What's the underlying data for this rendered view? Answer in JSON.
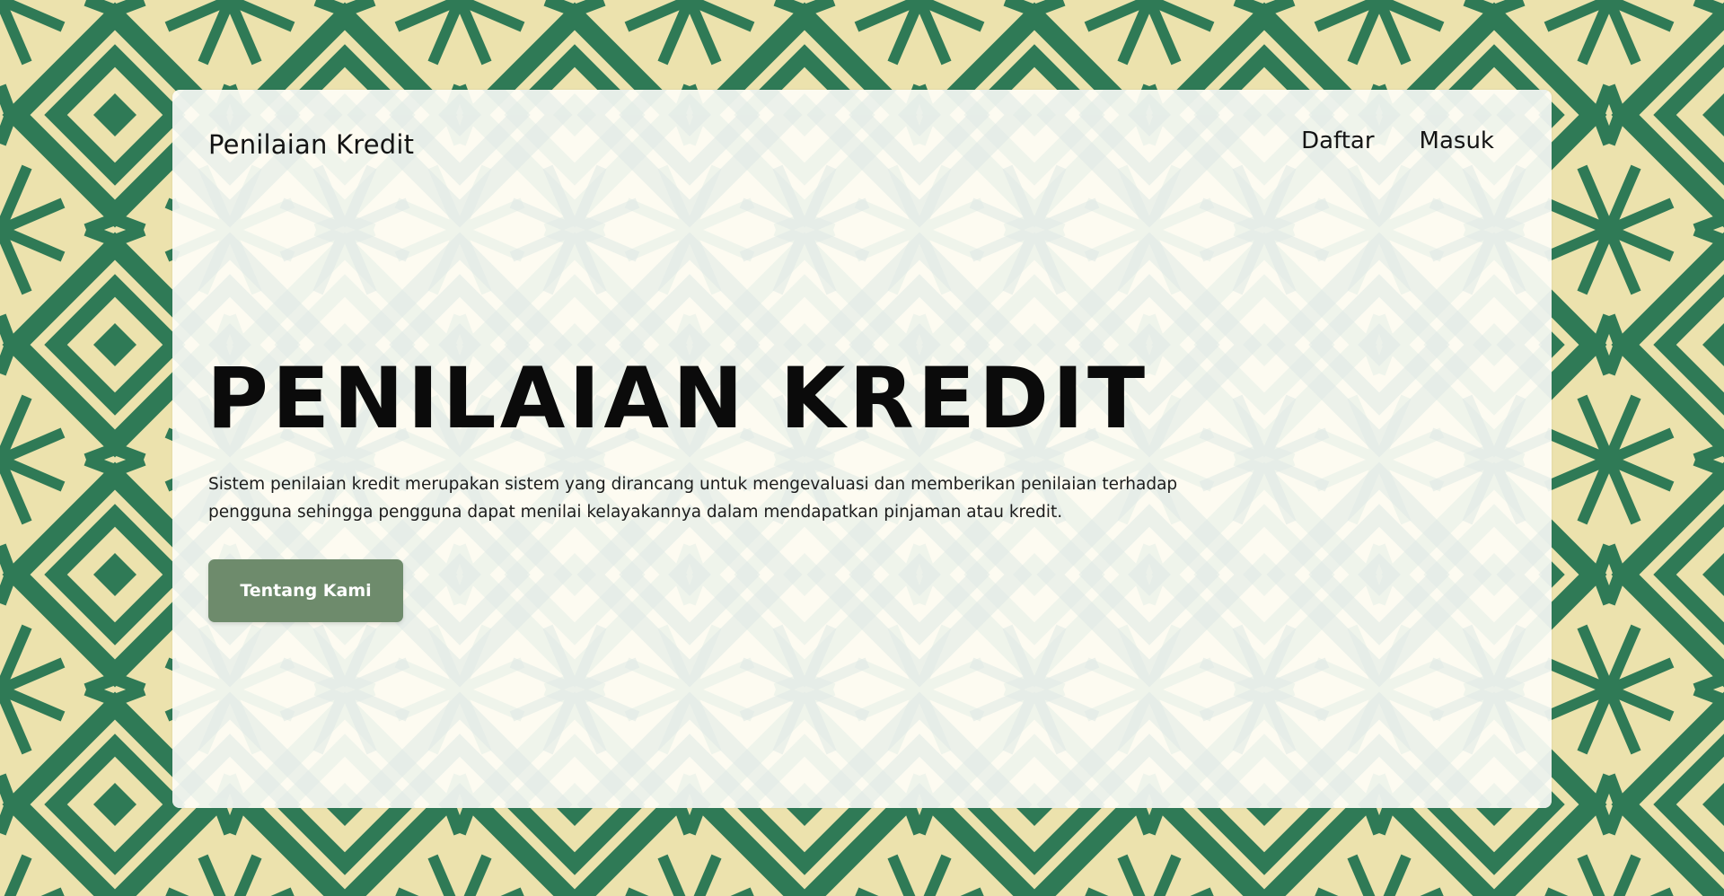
{
  "brand": {
    "title": "Penilaian Kredit"
  },
  "nav": {
    "items": [
      {
        "label": "Daftar"
      },
      {
        "label": "Masuk"
      }
    ]
  },
  "hero": {
    "title": "PENILAIAN KREDIT",
    "description": "Sistem penilaian kredit merupakan sistem yang dirancang untuk mengevaluasi dan memberikan penilaian terhadap pengguna sehingga pengguna dapat menilai kelayakannya dalam mendapatkan pinjaman atau kredit.",
    "cta_label": "Tentang Kami"
  },
  "colors": {
    "pattern_green": "#2f7a56",
    "pattern_cream": "#ece2ad",
    "card_background": "#fefdf6",
    "button_background": "#6e8b6c",
    "button_text": "#ffffff",
    "text": "#0b0b0b"
  }
}
